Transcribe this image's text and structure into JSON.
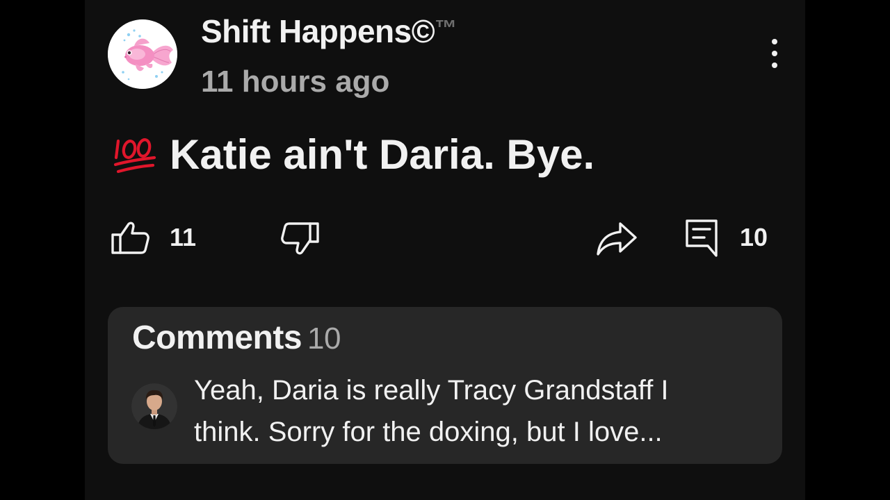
{
  "post": {
    "author": "Shift Happens©",
    "author_suffix": "™",
    "timestamp": "11 hours ago",
    "text": "Katie ain't Daria. Bye.",
    "emoji_icon": "hundred-points-icon",
    "more_icon": "more-vertical-icon"
  },
  "actions": {
    "like_count": "11",
    "reply_count": "10",
    "like_icon": "thumbs-up-icon",
    "dislike_icon": "thumbs-down-icon",
    "share_icon": "share-arrow-icon",
    "comment_icon": "comment-bubble-icon"
  },
  "comments": {
    "title": "Comments",
    "count": "10",
    "preview_text": "Yeah, Daria is really Tracy Grandstaff I\nthink.  Sorry for the doxing, but I love..."
  },
  "colors": {
    "background": "#000000",
    "panel": "#0f0f0f",
    "card": "#272727",
    "text": "#f1f1f1",
    "muted": "#aaaaaa",
    "emoji_red": "#e0162b"
  }
}
